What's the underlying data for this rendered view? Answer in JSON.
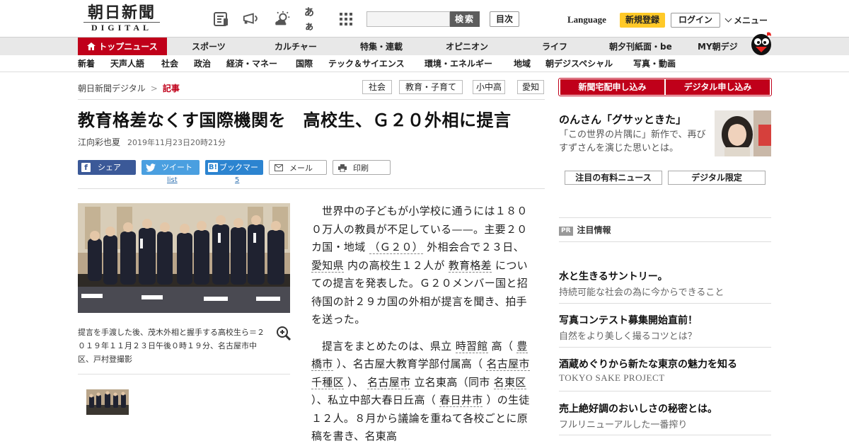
{
  "header": {
    "logo_jp": "朝日新聞",
    "logo_en": "DIGITAL",
    "search_button": "検索",
    "contents_button": "目次",
    "language": "Language",
    "register": "新規登録",
    "login": "ログイン",
    "menu": "メニュー",
    "font_size_icon_label": "あぁ"
  },
  "nav_primary": [
    "トップニュース",
    "スポーツ",
    "カルチャー",
    "特集・連載",
    "オピニオン",
    "ライフ",
    "朝夕刊紙面・be",
    "MY朝デジ"
  ],
  "nav_secondary": [
    "新着",
    "天声人語",
    "社会",
    "政治",
    "経済・マネー",
    "国際",
    "テック＆サイエンス",
    "環境・エネルギー",
    "地域",
    "朝デジスペシャル",
    "写真・動画"
  ],
  "breadcrumb": {
    "home": "朝日新聞デジタル",
    "separator": ">",
    "current": "記事"
  },
  "tags": [
    "社会",
    "教育・子育て",
    "小中高",
    "愛知"
  ],
  "article": {
    "headline": "教育格差なくす国際機関を　高校生、Ｇ２０外相に提言",
    "author": "江向彩也夏",
    "date": "2019年11月23日20時21分",
    "share": {
      "facebook": "シェア",
      "twitter": "ツイート",
      "twitter_sub": "list",
      "hatena": "ブックマーク",
      "hatena_sub": "5",
      "mail": "メール",
      "print": "印刷"
    },
    "photo_caption": "提言を手渡した後、茂木外相と握手する高校生ら＝２０１９年１１月２３日午後０時１９分、名古屋市中区、戸村登撮影",
    "p1": {
      "t1": "世界中の子どもが小学校に通うには１８００万人の教員が不足している——。主要２０カ国・地域",
      "l1": "（Ｇ２０）",
      "t2": "外相会合で２３日、",
      "l2": "愛知県",
      "t3": "内の高校生１２人が",
      "l3": "教育格差",
      "t4": "についての提言を発表した。Ｇ２０メンバー国と招待国の計２９カ国の外相が提言を聞き、拍手を送った。"
    },
    "p2": {
      "t1": "提言をまとめたのは、県立",
      "l1": "時習館",
      "t2": "高（",
      "l2": "豊橋市",
      "t3": "）、名古屋大教育学部付属高（",
      "l3": "名古屋市",
      "l4": "千種区",
      "t4": "）、",
      "l5": "名古屋市",
      "t5": "立名東高（同市",
      "l6": "名東区",
      "t6": "）、私立中部大春日丘高（",
      "l7": "春日井市",
      "t7": "）の生徒１２人。８月から議論を重ねて各校ごとに原稿を書き、名東高"
    }
  },
  "sidebar": {
    "btn_newspaper": "新聞宅配申し込み",
    "btn_digital": "デジタル申し込み",
    "feature_title": "のんさん「グサッときた」",
    "feature_desc": "「この世界の片隅に」新作で、再びすずさんを演じた思いとは。",
    "btn_paid_news": "注目の有料ニュース",
    "btn_digital_only": "デジタル限定",
    "pr_badge": "PR",
    "pr_heading": "注目情報",
    "pr_items": [
      {
        "title": "水と生きるサントリー。",
        "sub": "持続可能な社会の為に今からできること"
      },
      {
        "title": "写真コンテスト募集開始直前！",
        "sub": "自然をより美しく撮るコツとは？"
      },
      {
        "title": "酒蔵めぐりから新たな東京の魅力を知る",
        "sub": "TOKYO SAKE PROJECT"
      },
      {
        "title": "売上絶好調のおいしさの秘密とは。",
        "sub": "フルリニューアルした一番搾り"
      }
    ]
  },
  "colors": {
    "brand_red": "#c0001a",
    "register_yellow": "#ffc928",
    "facebook": "#3b5998",
    "twitter": "#4a9fe0",
    "hatena": "#2c84d0"
  }
}
